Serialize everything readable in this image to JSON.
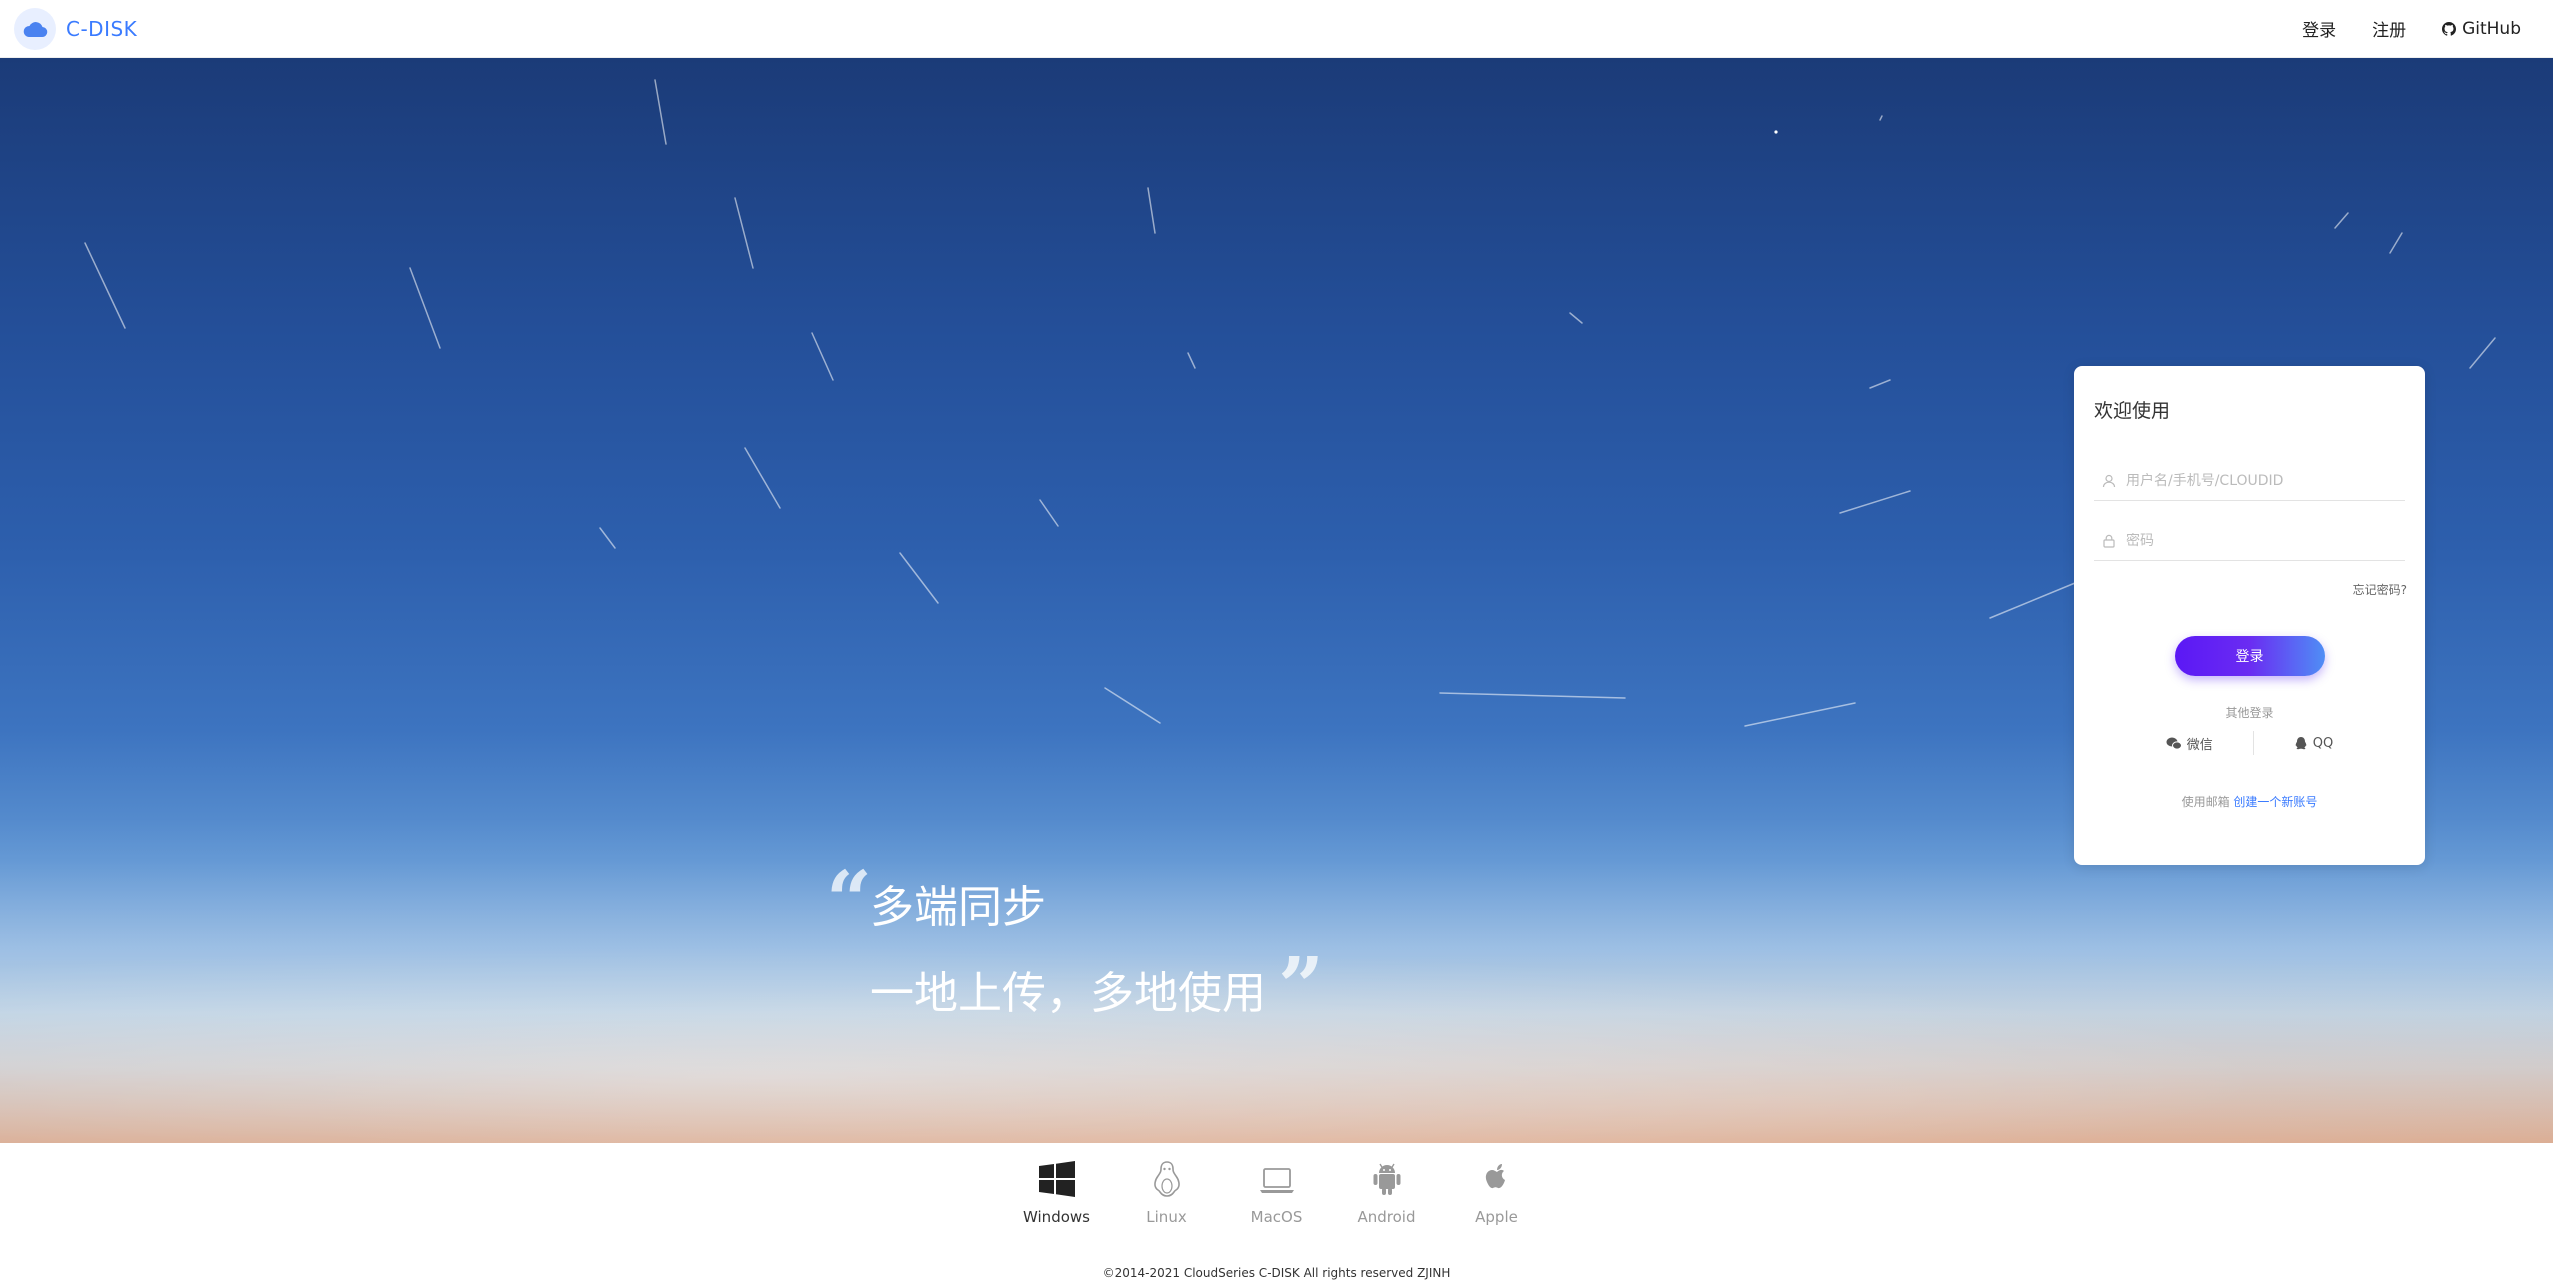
{
  "header": {
    "brand": "C-DISK",
    "nav": {
      "login": "登录",
      "register": "注册",
      "github": "GitHub"
    }
  },
  "hero": {
    "slogan_line1": "多端同步",
    "slogan_line2": "一地上传，多地使用"
  },
  "login_card": {
    "title": "欢迎使用",
    "username_placeholder": "用户名/手机号/CLOUDID",
    "password_placeholder": "密码",
    "forgot_password": "忘记密码?",
    "submit": "登录",
    "other_login_title": "其他登录",
    "wechat": "微信",
    "qq": "QQ",
    "register_prefix": "使用邮箱",
    "register_link": "创建一个新账号"
  },
  "platforms": [
    {
      "label": "Windows",
      "icon": "windows-icon",
      "active": true
    },
    {
      "label": "Linux",
      "icon": "linux-icon",
      "active": false
    },
    {
      "label": "MacOS",
      "icon": "laptop-icon",
      "active": false
    },
    {
      "label": "Android",
      "icon": "android-icon",
      "active": false
    },
    {
      "label": "Apple",
      "icon": "apple-icon",
      "active": false
    }
  ],
  "footer": {
    "copyright": "©2014-2021 CloudSeries C-DISK All rights reserved ZJINH"
  },
  "colors": {
    "accent": "#3a7bff",
    "button_start": "#5b18f5",
    "button_end": "#4f8ef5"
  }
}
